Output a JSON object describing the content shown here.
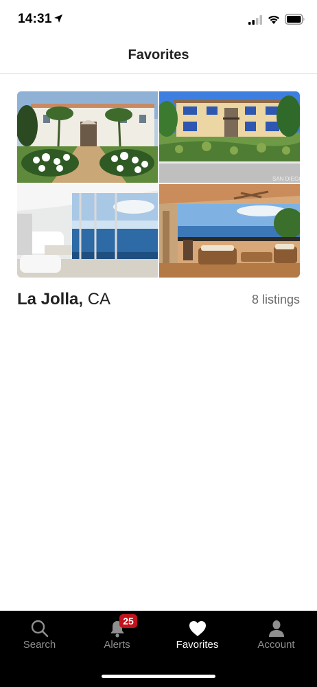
{
  "status_bar": {
    "time": "14:31",
    "icons": [
      "location-arrow-icon",
      "signal-icon",
      "wifi-icon",
      "battery-icon"
    ]
  },
  "header": {
    "title": "Favorites"
  },
  "collection": {
    "city": "La Jolla,",
    "state": "CA",
    "listings": "8 listings",
    "photos": [
      "mediterranean-villa-photo",
      "modern-house-hillside-photo",
      "ocean-view-living-room-photo",
      "patio-ocean-view-photo"
    ],
    "photo_watermark": "SAN DIEGO"
  },
  "tab_bar": {
    "tabs": [
      {
        "label": "Search",
        "icon": "search-icon",
        "active": false
      },
      {
        "label": "Alerts",
        "icon": "bell-icon",
        "active": false,
        "badge": "25"
      },
      {
        "label": "Favorites",
        "icon": "heart-icon",
        "active": true
      },
      {
        "label": "Account",
        "icon": "person-icon",
        "active": false
      }
    ]
  },
  "colors": {
    "badge": "#c2121b",
    "tab_bar_bg": "#000000",
    "inactive_tab": "#8e8e8e",
    "active_tab": "#ffffff"
  }
}
